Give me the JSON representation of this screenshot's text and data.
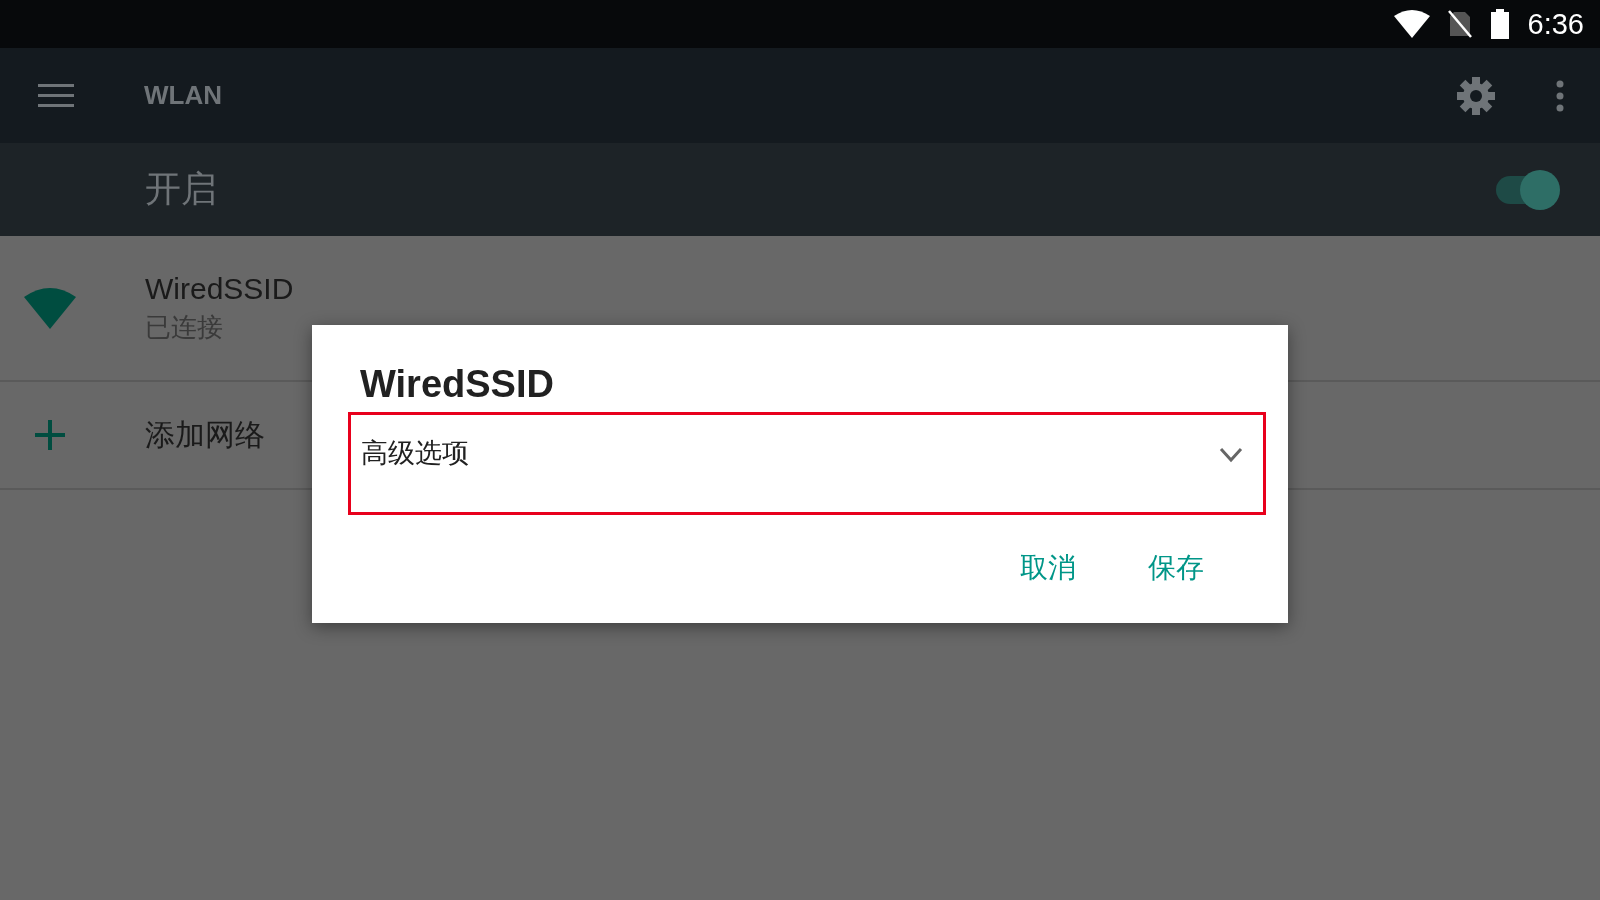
{
  "status_bar": {
    "time": "6:36"
  },
  "app_bar": {
    "title": "WLAN"
  },
  "wifi_switch": {
    "label": "开启",
    "on": true
  },
  "networks": [
    {
      "kind": "network",
      "name": "WiredSSID",
      "status": "已连接"
    },
    {
      "kind": "add",
      "name": "添加网络"
    }
  ],
  "dialog": {
    "title": "WiredSSID",
    "advanced_options": {
      "label": "高级选项",
      "expanded": false,
      "highlighted": true
    },
    "buttons": [
      "取消",
      "保存"
    ]
  }
}
